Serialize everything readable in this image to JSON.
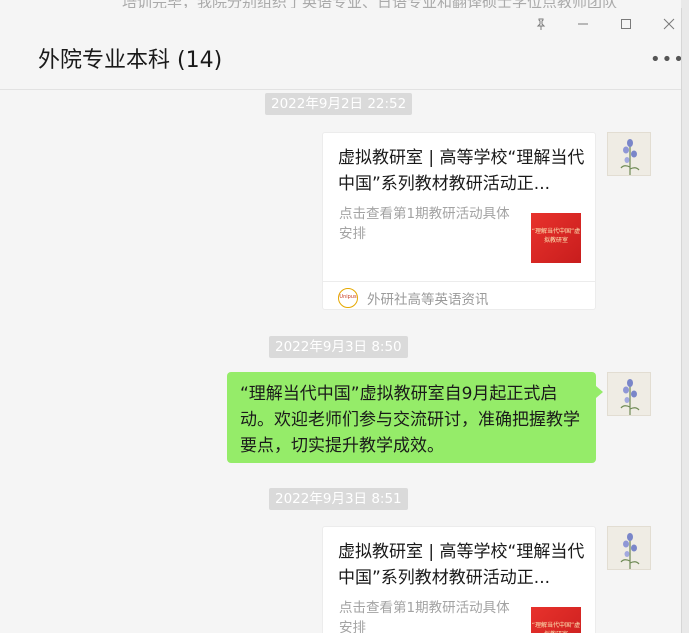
{
  "background_text": "培训完毕，我院分别组织了英语专业、日语专业和翻译硕士学位点教师团队",
  "header": {
    "title": "外院专业本科 (14)",
    "pin_icon": "pin-icon",
    "minimize_icon": "minimize-icon",
    "maximize_icon": "maximize-icon",
    "close_icon": "close-icon",
    "more_icon": "more-icon"
  },
  "messages": [
    {
      "timestamp": "2022年9月2日 22:52",
      "type": "article",
      "title": "虚拟教研室 | 高等学校“理解当代中国”系列教材教研活动正...",
      "desc": "点击查看第1期教研活动具体安排",
      "thumb_text": "“理解当代中国”虚拟教研室",
      "source": "外研社高等英语资讯",
      "source_icon_text": "Unipus"
    },
    {
      "timestamp": "2022年9月3日 8:50",
      "type": "text",
      "text": "“理解当代中国”虚拟教研室自9月起正式启动。欢迎老师们参与交流研讨，准确把握教学要点，切实提升教学成效。"
    },
    {
      "timestamp": "2022年9月3日 8:51",
      "type": "article",
      "title": "虚拟教研室 | 高等学校“理解当代中国”系列教材教研活动正...",
      "desc": "点击查看第1期教研活动具体安排",
      "thumb_text": "“理解当代中国”虚拟教研室"
    }
  ],
  "colors": {
    "bubble": "#95ec69",
    "timestamp_bg": "#dadada",
    "thumb": "#e0302a"
  }
}
